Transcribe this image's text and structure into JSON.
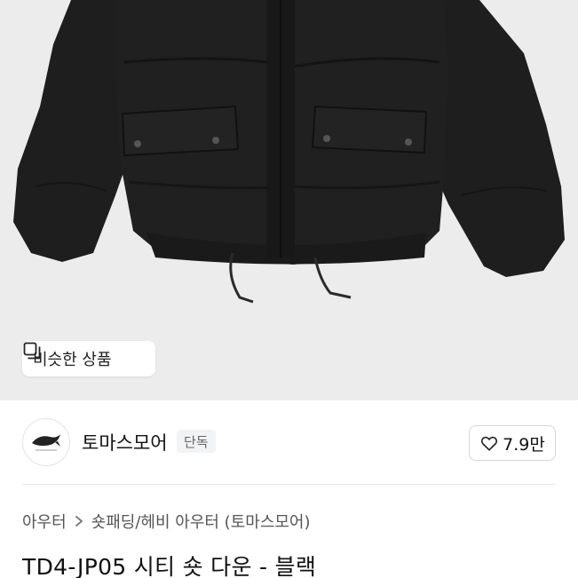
{
  "hero": {
    "similar_button_label": "비슷한 상품",
    "background_color": "#ececec",
    "jacket_color": "#1b1b1b"
  },
  "brand": {
    "name": "토마스모어",
    "badge": "단독",
    "logo_icon": "whale-logo-icon"
  },
  "like": {
    "count": "7.9만",
    "icon": "heart-outline-icon"
  },
  "breadcrumb": {
    "items": [
      "아우터",
      "숏패딩/헤비 아우터 (토마스모어)"
    ]
  },
  "product": {
    "title": "TD4-JP05 시티 숏 다운 - 블랙"
  }
}
